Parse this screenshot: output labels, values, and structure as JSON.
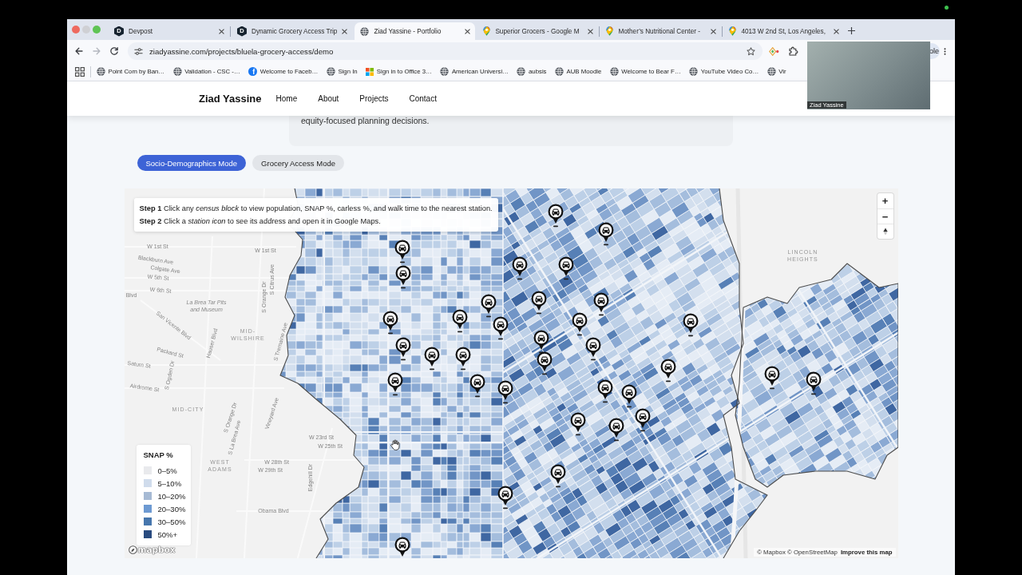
{
  "browser": {
    "tabs": [
      {
        "title": "Devpost",
        "kind": "hex-badge",
        "badge": "D",
        "selected": false
      },
      {
        "title": "Dynamic Grocery Access Trip",
        "kind": "hex-badge",
        "badge": "D",
        "selected": false
      },
      {
        "title": "Ziad Yassine - Portfolio",
        "kind": "globe",
        "selected": true
      },
      {
        "title": "Superior Grocers - Google M",
        "kind": "map-pin",
        "selected": false
      },
      {
        "title": "Mother’s Nutritional Center -",
        "kind": "map-pin",
        "selected": false
      },
      {
        "title": "4013 W 2nd St, Los Angeles,",
        "kind": "map-pin",
        "selected": false
      }
    ],
    "toolbar": {
      "nav_buttons": [
        {
          "kind": "back",
          "disabled": false
        },
        {
          "kind": "forward",
          "disabled": true
        },
        {
          "kind": "reload",
          "disabled": false
        }
      ],
      "url": "ziadyassine.com/projects/bluela-grocery-access/demo",
      "profile_chip": "ole"
    },
    "bookmarks": [
      {
        "label": "Point Com by Ban…",
        "kind": "globe"
      },
      {
        "label": "Validation - CSC -…",
        "kind": "globe"
      },
      {
        "label": "Welcome to Faceb…",
        "kind": "round-badge",
        "badge": "f"
      },
      {
        "label": "Sign In",
        "kind": "globe"
      },
      {
        "label": "Sign in to Office 3…",
        "kind": "tiles"
      },
      {
        "label": "American Universi…",
        "kind": "globe"
      },
      {
        "label": "aubsis",
        "kind": "globe"
      },
      {
        "label": "AUB Moodle",
        "kind": "globe"
      },
      {
        "label": "Welcome to Bear F…",
        "kind": "globe"
      },
      {
        "label": "YouTube Video Co…",
        "kind": "globe"
      },
      {
        "label": "Vir",
        "kind": "globe"
      }
    ]
  },
  "page": {
    "header": {
      "brand": "Ziad Yassine",
      "nav": [
        "Home",
        "About",
        "Projects",
        "Contact"
      ]
    },
    "intro_card": {
      "text": "equity-focused planning decisions."
    },
    "modes": [
      {
        "label": "Socio-Demographics Mode",
        "selected": true
      },
      {
        "label": "Grocery Access Mode",
        "selected": false
      }
    ],
    "map": {
      "instructions": [
        "**Step 1** Click any *census block* to view population, SNAP %, carless %, and walk time to the nearest station.",
        "**Step 2** Click a *station icon* to see its address and open it in Google Maps."
      ],
      "labels": [
        {
          "text": "W 1st St",
          "kind": "street"
        },
        {
          "text": "W 1st St",
          "kind": "street"
        },
        {
          "text": "Blackburn Ave",
          "kind": "street"
        },
        {
          "text": "Colgate Ave",
          "kind": "street"
        },
        {
          "text": "W 5th St",
          "kind": "street"
        },
        {
          "text": "W 6th St",
          "kind": "street"
        },
        {
          "text": "Blvd",
          "kind": "street"
        },
        {
          "text": "La Brea Tar Pits and Museum",
          "kind": "place"
        },
        {
          "text": "San Vicente Blvd",
          "kind": "street"
        },
        {
          "text": "MID-WILSHIRE",
          "kind": "area"
        },
        {
          "text": "S Orange Dr",
          "kind": "street"
        },
        {
          "text": "S Citrus Ave",
          "kind": "street"
        },
        {
          "text": "S Tremaine Ave",
          "kind": "street"
        },
        {
          "text": "Hauser Blvd",
          "kind": "street"
        },
        {
          "text": "Packard St",
          "kind": "street"
        },
        {
          "text": "Saturn St",
          "kind": "street"
        },
        {
          "text": "S Ogden Dr",
          "kind": "street"
        },
        {
          "text": "Airdrome St",
          "kind": "street"
        },
        {
          "text": "MID-CITY",
          "kind": "area"
        },
        {
          "text": "S Orange Dr",
          "kind": "street"
        },
        {
          "text": "S La Brea Ave",
          "kind": "street"
        },
        {
          "text": "Vineyard Ave",
          "kind": "street"
        },
        {
          "text": "W 23rd St",
          "kind": "street"
        },
        {
          "text": "W 25th St",
          "kind": "street"
        },
        {
          "text": "W 28th St",
          "kind": "street"
        },
        {
          "text": "W 29th St",
          "kind": "street"
        },
        {
          "text": "WEST ADAMS",
          "kind": "area"
        },
        {
          "text": "Edgehill Dr",
          "kind": "street"
        },
        {
          "text": "Obama Blvd",
          "kind": "street"
        },
        {
          "text": "LINCOLN HEIGHTS",
          "kind": "area"
        }
      ],
      "legend": {
        "title": "SNAP %",
        "items": [
          {
            "label": "0–5%",
            "color": "#e9eaed"
          },
          {
            "label": "5–10%",
            "color": "#d0dcec"
          },
          {
            "label": "10–20%",
            "color": "#a6bad4"
          },
          {
            "label": "20–30%",
            "color": "#6d9ad2"
          },
          {
            "label": "30–50%",
            "color": "#4676ad"
          },
          {
            "label": "50%+",
            "color": "#294b7f"
          }
        ]
      },
      "zoom_controls": [
        "+",
        "−"
      ],
      "logo": "mapbox",
      "attribution": "© Mapbox © OpenStreetMap",
      "improve_link": "Improve this map"
    }
  },
  "video_tile": {
    "name": "Ziad Yassine"
  }
}
